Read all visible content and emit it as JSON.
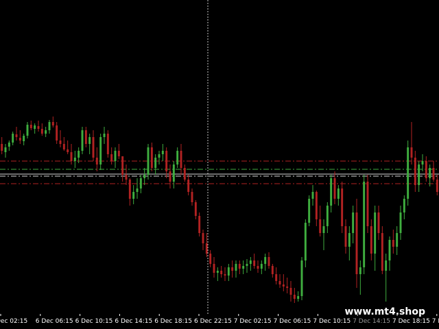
{
  "colors": {
    "background": "#000000",
    "bull": "#3fae3f",
    "bear": "#b22222",
    "level_red": "#b22222",
    "level_green": "#3fae3f",
    "level_white": "#d8d8d8",
    "crosshair": "#c8c8c8",
    "tick_text": "#ffffff",
    "tick_text_dim": "#9a9a9a"
  },
  "watermark": "www.mt4.shop",
  "chart_data": {
    "type": "candlestick",
    "x_tick_labels": [
      "Dec 02:15",
      "6 Dec 06:15",
      "6 Dec 10:15",
      "6 Dec 14:15",
      "6 Dec 18:15",
      "6 Dec 22:15",
      "7 Dec 02:15",
      "7 Dec 06:15",
      "7 Dec 10:15",
      "7 Dec 14:15",
      "7 Dec 18:15",
      "7 De"
    ],
    "dim_tick_index": 9,
    "levels": [
      {
        "value": 235,
        "style": "dashdot",
        "color": "level_red"
      },
      {
        "value": 247,
        "style": "dashdot",
        "color": "level_green"
      },
      {
        "value": 254,
        "style": "solid",
        "color": "level_white"
      },
      {
        "value": 257,
        "style": "dashdot",
        "color": "level_white"
      },
      {
        "value": 268,
        "style": "dashdot",
        "color": "level_red"
      }
    ],
    "candles": [
      [
        210,
        200,
        225,
        220
      ],
      [
        222,
        210,
        230,
        215
      ],
      [
        214,
        205,
        220,
        208
      ],
      [
        208,
        192,
        212,
        195
      ],
      [
        196,
        185,
        205,
        200
      ],
      [
        201,
        190,
        210,
        205
      ],
      [
        206,
        195,
        212,
        198
      ],
      [
        198,
        178,
        202,
        182
      ],
      [
        182,
        176,
        190,
        187
      ],
      [
        188,
        180,
        195,
        183
      ],
      [
        184,
        176,
        192,
        188
      ],
      [
        188,
        180,
        198,
        195
      ],
      [
        195,
        185,
        200,
        190
      ],
      [
        190,
        175,
        195,
        178
      ],
      [
        178,
        170,
        186,
        183
      ],
      [
        183,
        178,
        210,
        205
      ],
      [
        205,
        190,
        215,
        210
      ],
      [
        210,
        200,
        220,
        218
      ],
      [
        218,
        205,
        225,
        222
      ],
      [
        222,
        210,
        240,
        235
      ],
      [
        235,
        220,
        245,
        230
      ],
      [
        230,
        215,
        238,
        220
      ],
      [
        220,
        185,
        225,
        190
      ],
      [
        190,
        185,
        215,
        210
      ],
      [
        210,
        195,
        225,
        200
      ],
      [
        200,
        190,
        235,
        230
      ],
      [
        230,
        215,
        250,
        240
      ],
      [
        240,
        195,
        248,
        200
      ],
      [
        200,
        185,
        210,
        195
      ],
      [
        195,
        190,
        230,
        225
      ],
      [
        225,
        215,
        240,
        235
      ],
      [
        235,
        215,
        245,
        220
      ],
      [
        220,
        210,
        232,
        228
      ],
      [
        228,
        240,
        265,
        255
      ],
      [
        255,
        240,
        270,
        262
      ],
      [
        262,
        260,
        300,
        290
      ],
      [
        290,
        270,
        298,
        280
      ],
      [
        280,
        260,
        290,
        275
      ],
      [
        275,
        255,
        282,
        260
      ],
      [
        260,
        245,
        270,
        255
      ],
      [
        255,
        210,
        262,
        215
      ],
      [
        215,
        208,
        250,
        245
      ],
      [
        245,
        225,
        255,
        230
      ],
      [
        230,
        220,
        240,
        225
      ],
      [
        225,
        210,
        235,
        220
      ],
      [
        220,
        215,
        260,
        250
      ],
      [
        250,
        240,
        275,
        265
      ],
      [
        265,
        235,
        275,
        240
      ],
      [
        240,
        215,
        245,
        220
      ],
      [
        220,
        210,
        255,
        245
      ],
      [
        245,
        240,
        265,
        262
      ],
      [
        262,
        255,
        285,
        280
      ],
      [
        280,
        275,
        300,
        295
      ],
      [
        295,
        292,
        320,
        315
      ],
      [
        315,
        310,
        345,
        340
      ],
      [
        340,
        335,
        365,
        355
      ],
      [
        355,
        340,
        375,
        370
      ],
      [
        370,
        365,
        390,
        385
      ],
      [
        385,
        375,
        405,
        398
      ],
      [
        398,
        390,
        410,
        395
      ],
      [
        395,
        388,
        405,
        400
      ],
      [
        400,
        390,
        410,
        402
      ],
      [
        402,
        385,
        410,
        390
      ],
      [
        390,
        380,
        405,
        395
      ],
      [
        395,
        380,
        405,
        385
      ],
      [
        385,
        380,
        400,
        392
      ],
      [
        392,
        380,
        400,
        388
      ],
      [
        388,
        378,
        398,
        385
      ],
      [
        385,
        375,
        395,
        380
      ],
      [
        380,
        370,
        392,
        388
      ],
      [
        388,
        380,
        398,
        392
      ],
      [
        392,
        380,
        400,
        385
      ],
      [
        385,
        370,
        395,
        375
      ],
      [
        375,
        368,
        392,
        388
      ],
      [
        388,
        385,
        405,
        400
      ],
      [
        400,
        390,
        415,
        410
      ],
      [
        410,
        400,
        420,
        415
      ],
      [
        415,
        400,
        425,
        418
      ],
      [
        418,
        405,
        428,
        420
      ],
      [
        420,
        410,
        440,
        430
      ],
      [
        430,
        420,
        442,
        436
      ],
      [
        436,
        425,
        440,
        432
      ],
      [
        432,
        375,
        438,
        380
      ],
      [
        380,
        320,
        390,
        325
      ],
      [
        325,
        285,
        330,
        290
      ],
      [
        290,
        270,
        300,
        280
      ],
      [
        280,
        278,
        330,
        320
      ],
      [
        320,
        300,
        345,
        340
      ],
      [
        340,
        320,
        365,
        330
      ],
      [
        330,
        295,
        340,
        300
      ],
      [
        300,
        255,
        310,
        260
      ],
      [
        260,
        250,
        298,
        290
      ],
      [
        290,
        270,
        300,
        275
      ],
      [
        275,
        265,
        340,
        330
      ],
      [
        330,
        320,
        370,
        360
      ],
      [
        360,
        330,
        380,
        340
      ],
      [
        340,
        300,
        355,
        310
      ],
      [
        310,
        290,
        420,
        400
      ],
      [
        400,
        380,
        430,
        390
      ],
      [
        390,
        255,
        400,
        265
      ],
      [
        265,
        255,
        340,
        330
      ],
      [
        330,
        320,
        380,
        370
      ],
      [
        370,
        300,
        395,
        310
      ],
      [
        310,
        300,
        350,
        340
      ],
      [
        340,
        330,
        400,
        395
      ],
      [
        395,
        370,
        440,
        380
      ],
      [
        380,
        345,
        395,
        350
      ],
      [
        350,
        335,
        370,
        360
      ],
      [
        360,
        330,
        372,
        340
      ],
      [
        340,
        300,
        350,
        310
      ],
      [
        310,
        285,
        320,
        290
      ],
      [
        290,
        205,
        300,
        215
      ],
      [
        215,
        178,
        240,
        230
      ],
      [
        230,
        220,
        280,
        270
      ],
      [
        270,
        235,
        280,
        240
      ],
      [
        240,
        225,
        250,
        235
      ],
      [
        235,
        228,
        265,
        260
      ],
      [
        260,
        240,
        272,
        245
      ],
      [
        245,
        235,
        265,
        262
      ],
      [
        262,
        255,
        285,
        280
      ]
    ]
  }
}
